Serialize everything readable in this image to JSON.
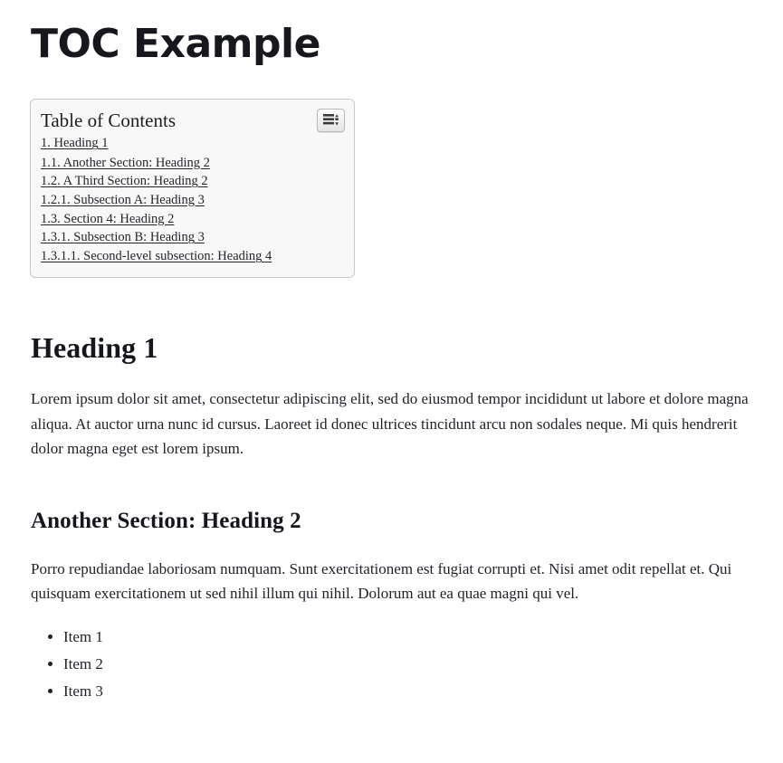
{
  "page": {
    "title": "TOC Example"
  },
  "toc": {
    "heading": "Table of Contents",
    "button": {
      "icon": "list-indent-icon",
      "title": "Toggle table of contents"
    },
    "items": [
      {
        "level": 1,
        "label": "1. Heading 1"
      },
      {
        "level": 2,
        "label": "1.1. Another Section: Heading 2"
      },
      {
        "level": 2,
        "label": "1.2. A Third Section: Heading 2"
      },
      {
        "level": 3,
        "label": "1.2.1. Subsection A: Heading 3"
      },
      {
        "level": 2,
        "label": "1.3. Section 4: Heading 2"
      },
      {
        "level": 3,
        "label": "1.3.1. Subsection B: Heading 3"
      },
      {
        "level": 4,
        "label": "1.3.1.1. Second-level subsection: Heading 4"
      }
    ]
  },
  "content": {
    "heading1": "Heading 1",
    "paragraph1": "Lorem ipsum dolor sit amet, consectetur adipiscing elit, sed do eiusmod tempor incididunt ut labore et dolore magna aliqua. At auctor urna nunc id cursus. Laoreet id donec ultrices tincidunt arcu non sodales neque. Mi quis hendrerit dolor magna eget est lorem ipsum.",
    "heading2": "Another Section: Heading 2",
    "paragraph2": "Porro repudiandae laboriosam numquam. Sunt exercitationem est fugiat corrupti et. Nisi amet odit repellat et. Qui quisquam exercitationem ut sed nihil illum qui nihil. Dolorum aut ea quae magni qui vel.",
    "list": [
      "Item 1",
      "Item 2",
      "Item 3"
    ]
  },
  "colors": {
    "text": "#1f2127",
    "heading": "#15171c",
    "toc_background": "#f8f8f8",
    "toc_border": "#c9c9c9",
    "link": "#24262b"
  }
}
